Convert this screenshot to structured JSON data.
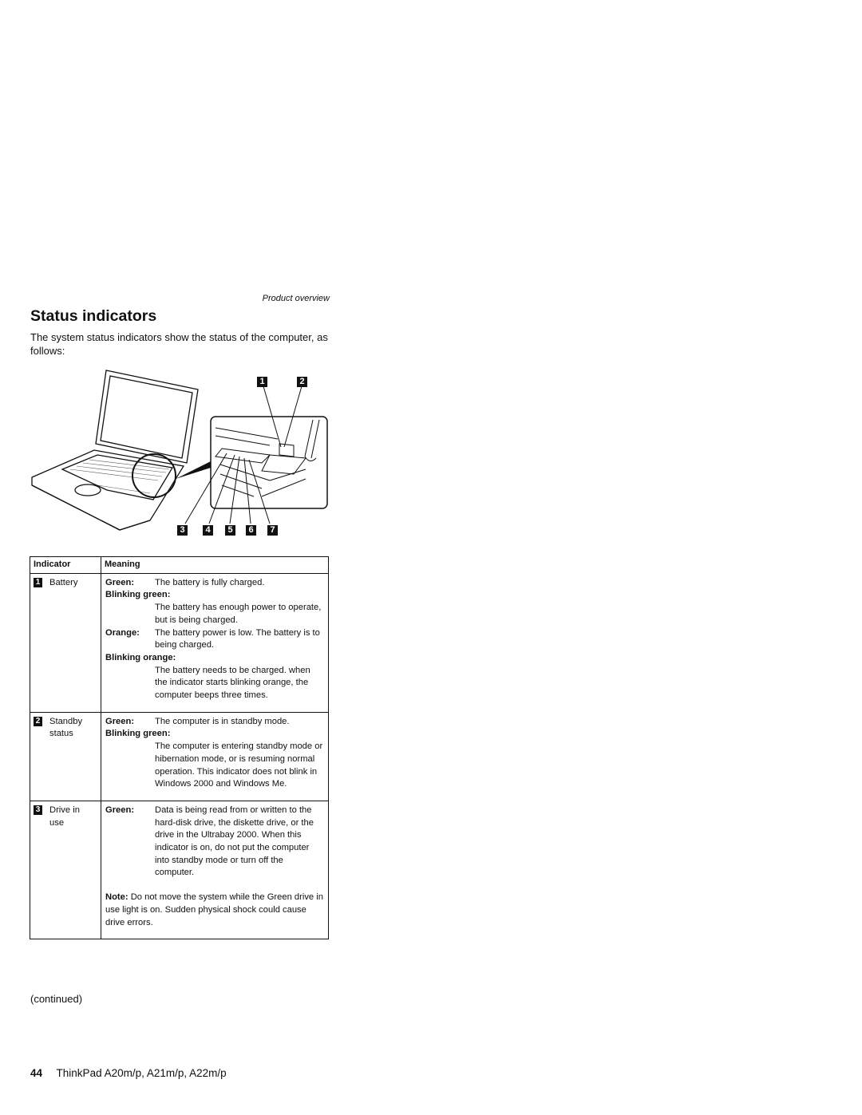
{
  "running_header": "Product overview",
  "title": "Status indicators",
  "intro": "The system status indicators show the status of the computer, as follows:",
  "figure": {
    "callouts_top": [
      "1",
      "2"
    ],
    "callouts_bottom": [
      "3",
      "4",
      "5",
      "6",
      "7"
    ]
  },
  "table": {
    "headers": [
      "Indicator",
      "Meaning"
    ],
    "rows": [
      {
        "num": "1",
        "indicator": "Battery",
        "entries": [
          {
            "label": "Green:",
            "text": "The battery is fully charged.",
            "inline": true
          },
          {
            "label": "Blinking green:",
            "text": "The battery has enough power to operate, but is being charged.",
            "inline": false
          },
          {
            "label": "Orange:",
            "text": "The battery power is low. The battery is to being charged.",
            "inline": true
          },
          {
            "label": "Blinking orange:",
            "text": "The battery needs to be charged. when the indicator starts blinking orange, the computer beeps three times.",
            "inline": false
          }
        ]
      },
      {
        "num": "2",
        "indicator": "Standby status",
        "entries": [
          {
            "label": "Green:",
            "text": "The computer is in standby mode.",
            "inline": true
          },
          {
            "label": "Blinking green:",
            "text": "The computer is entering standby mode or hibernation mode, or is resuming normal operation. This indicator does not blink in Windows 2000 and Windows Me.",
            "inline": false
          }
        ]
      },
      {
        "num": "3",
        "indicator": "Drive in use",
        "entries": [
          {
            "label": "Green:",
            "text": "Data is being read from or written to the hard-disk drive, the diskette drive, or the drive in the Ultrabay 2000. When this indicator is on, do not put the computer into standby mode or turn off the computer.",
            "inline": true
          }
        ],
        "note_label": "Note:",
        "note_text": "Do not move the system while the Green drive in use light is on. Sudden physical shock could cause drive errors."
      }
    ]
  },
  "continued": "(continued)",
  "footer": {
    "page_number": "44",
    "text": "ThinkPad A20m/p, A21m/p, A22m/p"
  }
}
